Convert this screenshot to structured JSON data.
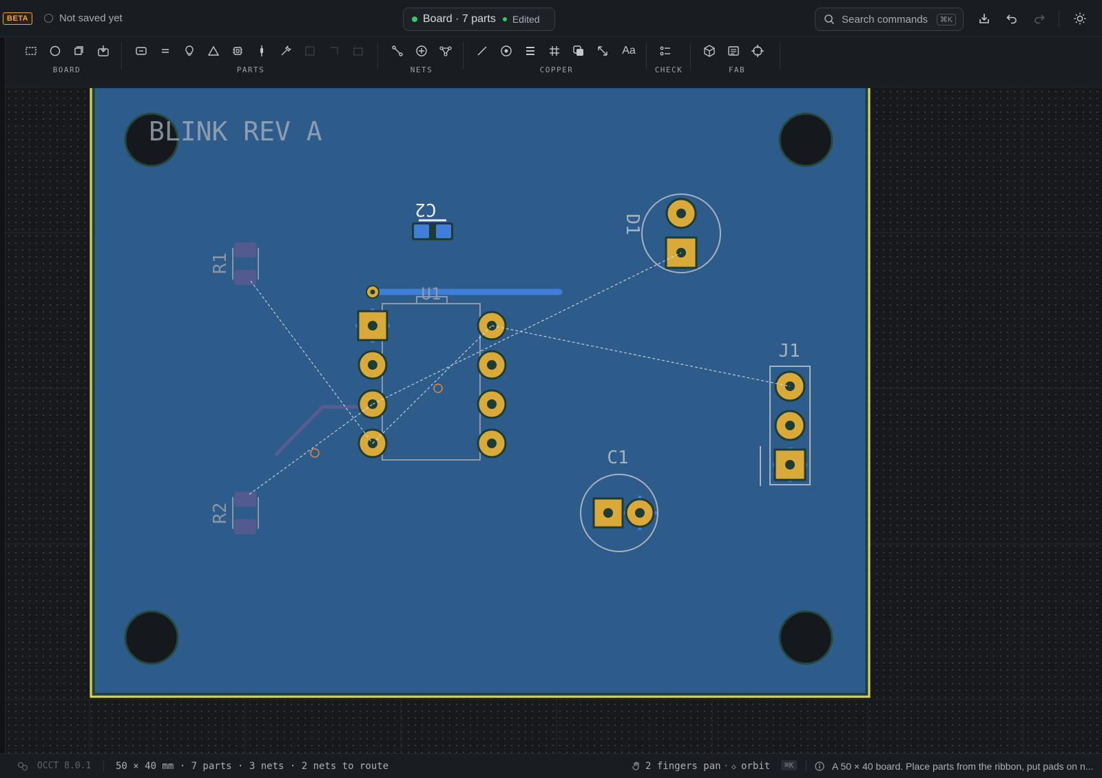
{
  "topbar": {
    "beta_badge": "BETA",
    "save_status": "Not saved yet",
    "doc_title": "Board · 7 parts",
    "doc_state": "Edited",
    "search_placeholder": "Search commands",
    "search_shortcut": "⌘K",
    "icons": [
      "download-icon",
      "undo-icon",
      "redo-icon",
      "theme-sun-icon"
    ]
  },
  "ribbon": {
    "groups": [
      {
        "label": "BOARD",
        "tools": [
          "select-rect-icon",
          "circle-icon",
          "stack-icon",
          "import-icon"
        ]
      },
      {
        "label": "PARTS",
        "tools": [
          "resistor-icon",
          "capacitor-icon",
          "led-icon",
          "diode-icon",
          "chip-icon",
          "pin-icon",
          "wrench-icon",
          "disabled-1",
          "disabled-2",
          "disabled-3"
        ]
      },
      {
        "label": "NETS",
        "tools": [
          "route-icon",
          "add-net-icon",
          "net-tree-icon"
        ]
      },
      {
        "label": "COPPER",
        "tools": [
          "trace-icon",
          "via-icon",
          "layers-icon",
          "grid-icon",
          "copy-icon",
          "expand-icon",
          "text-icon"
        ]
      },
      {
        "label": "CHECK",
        "tools": [
          "checklist-icon"
        ]
      },
      {
        "label": "FAB",
        "tools": [
          "3d-box-icon",
          "gerber-icon",
          "crosshair-icon"
        ]
      }
    ],
    "text_tool_glyph": "Aa"
  },
  "board": {
    "silk_title": "BLINK REV A",
    "designators": {
      "r1": "R1",
      "r2": "R2",
      "c2": "C2",
      "u1": "U1",
      "d1": "D1",
      "j1": "J1",
      "c1": "C1"
    },
    "colors": {
      "board": "#2d5b8a",
      "outline": "#e3d63f",
      "pad": "#d9a93a",
      "silk": "#b9c3cf",
      "trace": "#3f7dd8",
      "ratsnest": "#d9e2ea"
    }
  },
  "statusbar": {
    "engine": "OCCT 8.0.1",
    "summary": "50 × 40 mm · 7 parts · 3 nets · 2 nets to route",
    "hint_pan": "2 fingers pan",
    "hint_orbit": "orbit",
    "hint_shortcut": "⌘K",
    "message": "A 50 × 40 board. Place parts from the ribbon, put pads on n..."
  }
}
